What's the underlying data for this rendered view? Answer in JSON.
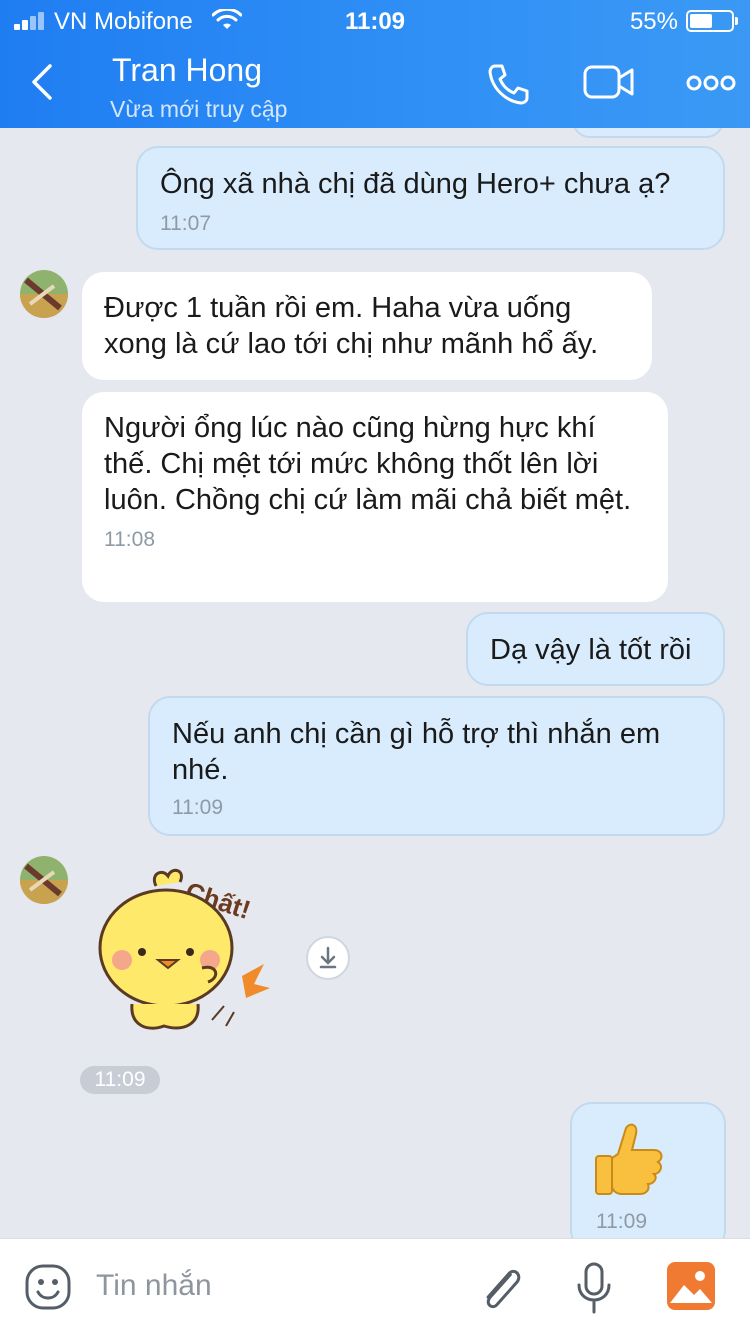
{
  "status_bar": {
    "carrier": "VN Mobifone",
    "time": "11:09",
    "battery_percent": "55%",
    "battery_level": 0.55,
    "signal_bars": 2
  },
  "header": {
    "title": "Tran Hong",
    "subtitle": "Vừa mới truy cập",
    "icons": [
      "back-icon",
      "phone-icon",
      "video-call-icon",
      "more-icon"
    ]
  },
  "messages": [
    {
      "side": "out",
      "text": "Ông xã nhà chị đã dùng Hero+ chưa ạ?",
      "time": "11:07"
    },
    {
      "side": "in",
      "text": "Được 1 tuần rồi em. Haha vừa uống xong là cứ lao tới chị như mãnh hổ ấy.",
      "time": ""
    },
    {
      "side": "in",
      "text": "Người ổng lúc nào cũng hừng hực khí thế. Chị mệt tới mức không thốt lên lời luôn. Chồng chị cứ làm mãi chả biết mệt.",
      "time": "11:08"
    },
    {
      "side": "out",
      "text": "Dạ vậy là tốt rồi",
      "time": ""
    },
    {
      "side": "out",
      "text": "Nếu anh chị cần gì hỗ trợ thì nhắn em nhé.",
      "time": "11:09"
    }
  ],
  "sticker": {
    "caption": "Chất!",
    "time": "11:09",
    "icon": "chick-sticker"
  },
  "thumbs_message": {
    "emoji": "thumbs-up",
    "time": "11:09"
  },
  "input_bar": {
    "placeholder": "Tin nhắn",
    "icons": [
      "emoji-icon",
      "attach-icon",
      "mic-icon",
      "photo-icon"
    ]
  },
  "colors": {
    "header": "#2f8ff5",
    "bubble_out": "#d8ecfd",
    "bubble_in": "#ffffff",
    "chat_bg": "#e5e8ef",
    "photo_icon": "#f07a32"
  }
}
